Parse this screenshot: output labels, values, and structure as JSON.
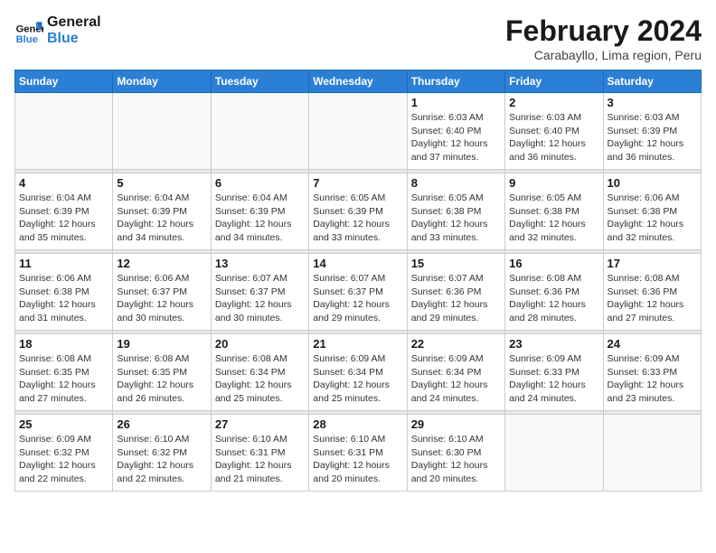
{
  "logo": {
    "line1": "General",
    "line2": "Blue"
  },
  "title": "February 2024",
  "subtitle": "Carabayllo, Lima region, Peru",
  "days_of_week": [
    "Sunday",
    "Monday",
    "Tuesday",
    "Wednesday",
    "Thursday",
    "Friday",
    "Saturday"
  ],
  "weeks": [
    {
      "cells": [
        {
          "empty": true
        },
        {
          "empty": true
        },
        {
          "empty": true
        },
        {
          "empty": true
        },
        {
          "day": 1,
          "sunrise": "6:03 AM",
          "sunset": "6:40 PM",
          "daylight": "12 hours and 37 minutes."
        },
        {
          "day": 2,
          "sunrise": "6:03 AM",
          "sunset": "6:40 PM",
          "daylight": "12 hours and 36 minutes."
        },
        {
          "day": 3,
          "sunrise": "6:03 AM",
          "sunset": "6:39 PM",
          "daylight": "12 hours and 36 minutes."
        }
      ]
    },
    {
      "cells": [
        {
          "day": 4,
          "sunrise": "6:04 AM",
          "sunset": "6:39 PM",
          "daylight": "12 hours and 35 minutes."
        },
        {
          "day": 5,
          "sunrise": "6:04 AM",
          "sunset": "6:39 PM",
          "daylight": "12 hours and 34 minutes."
        },
        {
          "day": 6,
          "sunrise": "6:04 AM",
          "sunset": "6:39 PM",
          "daylight": "12 hours and 34 minutes."
        },
        {
          "day": 7,
          "sunrise": "6:05 AM",
          "sunset": "6:39 PM",
          "daylight": "12 hours and 33 minutes."
        },
        {
          "day": 8,
          "sunrise": "6:05 AM",
          "sunset": "6:38 PM",
          "daylight": "12 hours and 33 minutes."
        },
        {
          "day": 9,
          "sunrise": "6:05 AM",
          "sunset": "6:38 PM",
          "daylight": "12 hours and 32 minutes."
        },
        {
          "day": 10,
          "sunrise": "6:06 AM",
          "sunset": "6:38 PM",
          "daylight": "12 hours and 32 minutes."
        }
      ]
    },
    {
      "cells": [
        {
          "day": 11,
          "sunrise": "6:06 AM",
          "sunset": "6:38 PM",
          "daylight": "12 hours and 31 minutes."
        },
        {
          "day": 12,
          "sunrise": "6:06 AM",
          "sunset": "6:37 PM",
          "daylight": "12 hours and 30 minutes."
        },
        {
          "day": 13,
          "sunrise": "6:07 AM",
          "sunset": "6:37 PM",
          "daylight": "12 hours and 30 minutes."
        },
        {
          "day": 14,
          "sunrise": "6:07 AM",
          "sunset": "6:37 PM",
          "daylight": "12 hours and 29 minutes."
        },
        {
          "day": 15,
          "sunrise": "6:07 AM",
          "sunset": "6:36 PM",
          "daylight": "12 hours and 29 minutes."
        },
        {
          "day": 16,
          "sunrise": "6:08 AM",
          "sunset": "6:36 PM",
          "daylight": "12 hours and 28 minutes."
        },
        {
          "day": 17,
          "sunrise": "6:08 AM",
          "sunset": "6:36 PM",
          "daylight": "12 hours and 27 minutes."
        }
      ]
    },
    {
      "cells": [
        {
          "day": 18,
          "sunrise": "6:08 AM",
          "sunset": "6:35 PM",
          "daylight": "12 hours and 27 minutes."
        },
        {
          "day": 19,
          "sunrise": "6:08 AM",
          "sunset": "6:35 PM",
          "daylight": "12 hours and 26 minutes."
        },
        {
          "day": 20,
          "sunrise": "6:08 AM",
          "sunset": "6:34 PM",
          "daylight": "12 hours and 25 minutes."
        },
        {
          "day": 21,
          "sunrise": "6:09 AM",
          "sunset": "6:34 PM",
          "daylight": "12 hours and 25 minutes."
        },
        {
          "day": 22,
          "sunrise": "6:09 AM",
          "sunset": "6:34 PM",
          "daylight": "12 hours and 24 minutes."
        },
        {
          "day": 23,
          "sunrise": "6:09 AM",
          "sunset": "6:33 PM",
          "daylight": "12 hours and 24 minutes."
        },
        {
          "day": 24,
          "sunrise": "6:09 AM",
          "sunset": "6:33 PM",
          "daylight": "12 hours and 23 minutes."
        }
      ]
    },
    {
      "cells": [
        {
          "day": 25,
          "sunrise": "6:09 AM",
          "sunset": "6:32 PM",
          "daylight": "12 hours and 22 minutes."
        },
        {
          "day": 26,
          "sunrise": "6:10 AM",
          "sunset": "6:32 PM",
          "daylight": "12 hours and 22 minutes."
        },
        {
          "day": 27,
          "sunrise": "6:10 AM",
          "sunset": "6:31 PM",
          "daylight": "12 hours and 21 minutes."
        },
        {
          "day": 28,
          "sunrise": "6:10 AM",
          "sunset": "6:31 PM",
          "daylight": "12 hours and 20 minutes."
        },
        {
          "day": 29,
          "sunrise": "6:10 AM",
          "sunset": "6:30 PM",
          "daylight": "12 hours and 20 minutes."
        },
        {
          "empty": true
        },
        {
          "empty": true
        }
      ]
    }
  ],
  "labels": {
    "sunrise": "Sunrise:",
    "sunset": "Sunset:",
    "daylight": "Daylight:"
  }
}
